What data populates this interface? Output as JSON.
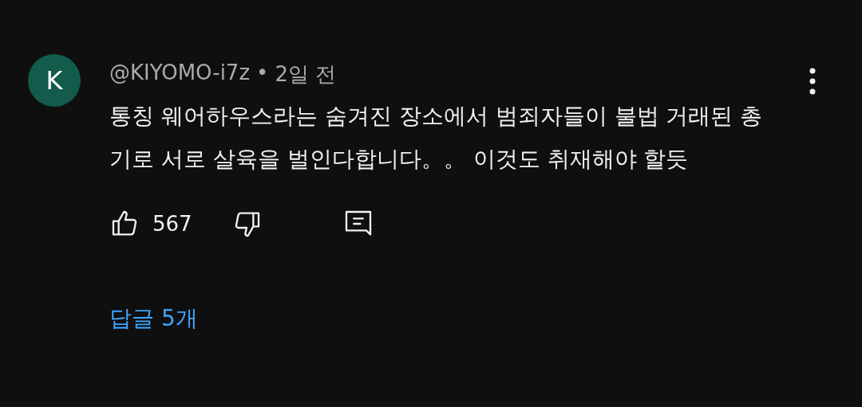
{
  "comment": {
    "avatar_letter": "K",
    "author": "@KIYOMO-i7z",
    "separator": "•",
    "time": "2일 전",
    "text": "통칭 웨어하우스라는 숨겨진 장소에서 범죄자들이 불법 거래된 총기로 서로 살육을 벌인다합니다。。 이것도 취재해야 할듯",
    "like_count": "567",
    "replies": "답글 5개"
  }
}
